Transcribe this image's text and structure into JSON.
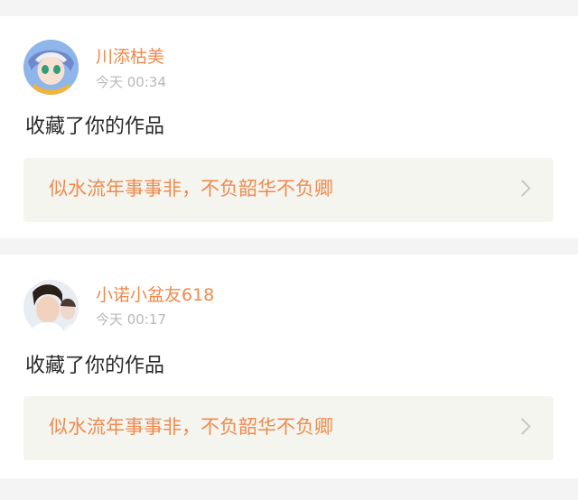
{
  "notifications": [
    {
      "username": "川添枯美",
      "time": "今天 00:34",
      "action": "收藏了你的作品",
      "work_title": "似水流年事事非，不负韶华不负卿",
      "avatar_icon": "anime-avatar"
    },
    {
      "username": "小诺小盆友618",
      "time": "今天 00:17",
      "action": "收藏了你的作品",
      "work_title": "似水流年事事非，不负韶华不负卿",
      "avatar_icon": "person-photo-avatar"
    }
  ],
  "colors": {
    "username": "#f0884a",
    "work_title": "#ef8a4f",
    "timestamp": "#b8b8b8",
    "background": "#f4f4f4",
    "work_box": "#f5f5ef"
  }
}
